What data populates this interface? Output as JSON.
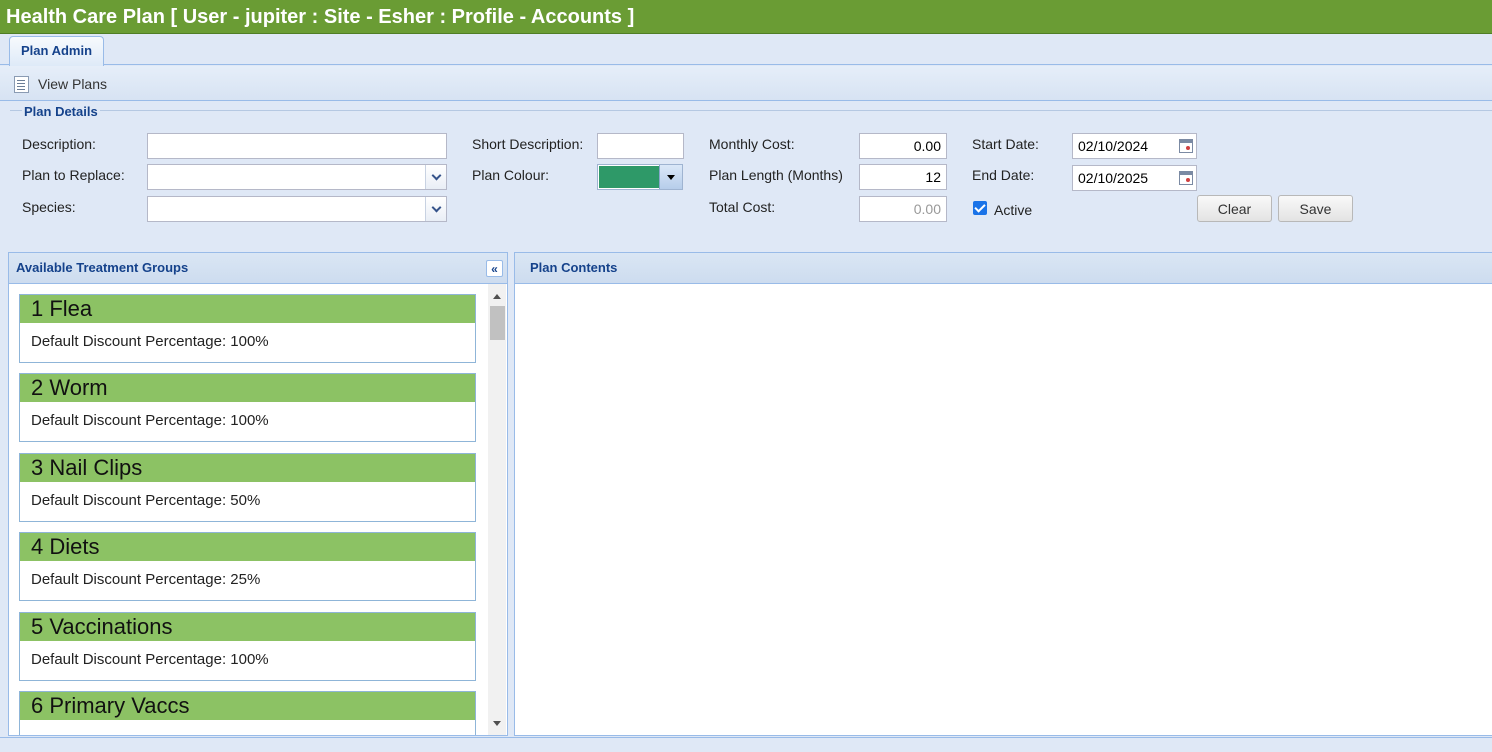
{
  "window": {
    "title": "Health Care Plan [ User - jupiter : Site - Esher : Profile - Accounts ]"
  },
  "tabs": [
    {
      "label": "Plan Admin",
      "active": true
    }
  ],
  "toolbar": {
    "view_plans": "View Plans",
    "icon": "document-list-icon"
  },
  "plan_details": {
    "legend": "Plan Details",
    "description": {
      "label": "Description:",
      "value": ""
    },
    "plan_to_replace": {
      "label": "Plan to Replace:",
      "value": ""
    },
    "species": {
      "label": "Species:",
      "value": ""
    },
    "short_description": {
      "label": "Short Description:",
      "value": ""
    },
    "plan_colour": {
      "label": "Plan Colour:",
      "value": "#2e9968"
    },
    "monthly_cost": {
      "label": "Monthly Cost:",
      "value": "0.00"
    },
    "plan_length": {
      "label": "Plan Length (Months)",
      "value": "12"
    },
    "total_cost": {
      "label": "Total Cost:",
      "value": "0.00"
    },
    "start_date": {
      "label": "Start Date:",
      "value": "02/10/2024"
    },
    "end_date": {
      "label": "End Date:",
      "value": "02/10/2025"
    },
    "active": {
      "label": "Active",
      "checked": true
    },
    "clear_label": "Clear",
    "save_label": "Save"
  },
  "available_groups": {
    "title": "Available Treatment Groups",
    "collapse_icon": "double-chevron-left-icon",
    "items": [
      {
        "title": "1 Flea",
        "detail": "Default Discount Percentage: 100%"
      },
      {
        "title": "2 Worm",
        "detail": "Default Discount Percentage: 100%"
      },
      {
        "title": "3 Nail Clips",
        "detail": "Default Discount Percentage: 50%"
      },
      {
        "title": "4 Diets",
        "detail": "Default Discount Percentage: 25%"
      },
      {
        "title": "5 Vaccinations",
        "detail": "Default Discount Percentage: 100%"
      },
      {
        "title": "6 Primary Vaccs",
        "detail": ""
      }
    ]
  },
  "plan_contents": {
    "title": "Plan Contents"
  },
  "colors": {
    "title_bar": "#6a9c34",
    "group_header": "#8cc264",
    "panel_text": "#15428b"
  }
}
